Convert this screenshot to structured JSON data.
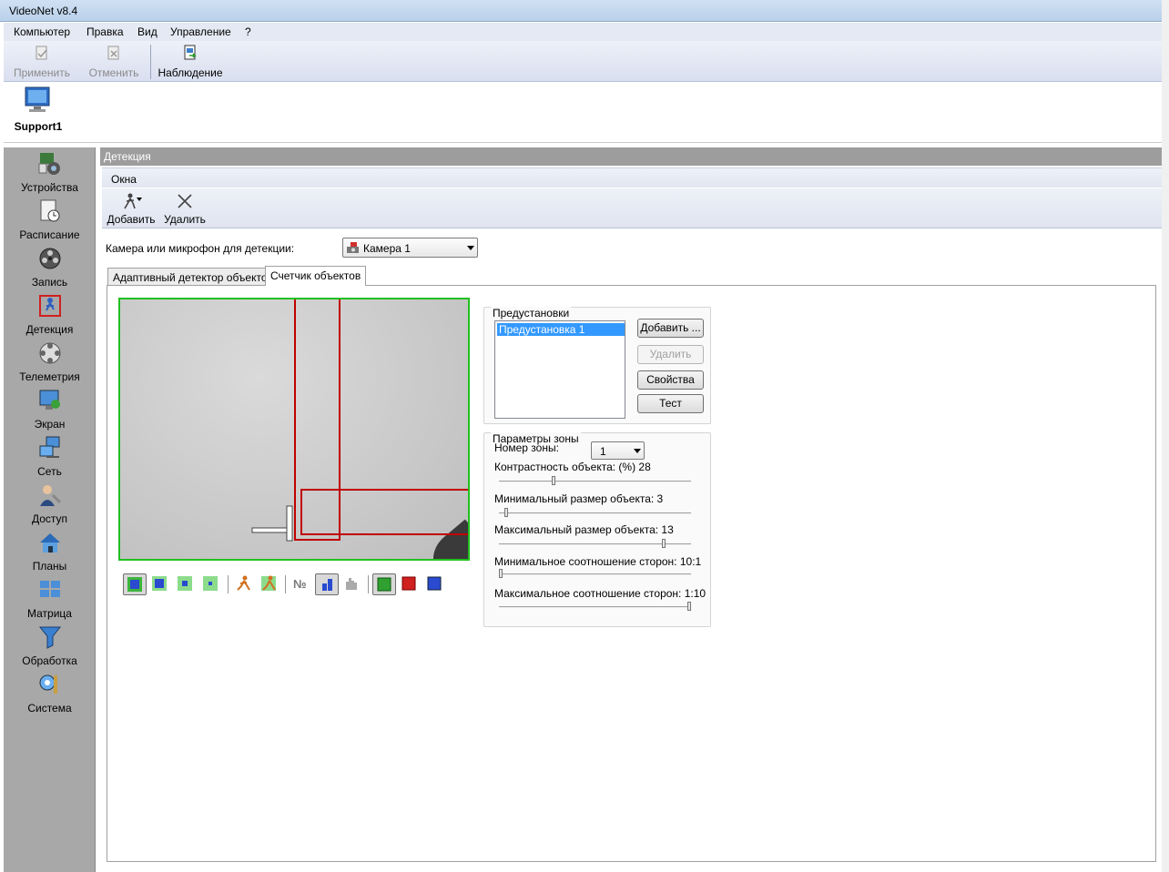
{
  "window": {
    "title": "VideoNet v8.4"
  },
  "menu": [
    "Компьютер",
    "Правка",
    "Вид",
    "Управление",
    "?"
  ],
  "toolbar": {
    "apply": "Применить",
    "cancel": "Отменить",
    "monitor": "Наблюдение"
  },
  "computer": {
    "name": "Support1"
  },
  "nav": [
    "Устройства",
    "Расписание",
    "Запись",
    "Детекция",
    "Телеметрия",
    "Экран",
    "Сеть",
    "Доступ",
    "Планы",
    "Матрица",
    "Обработка",
    "Система"
  ],
  "panel": {
    "title": "Детекция",
    "windows_menu": "Окна",
    "add": "Добавить",
    "delete": "Удалить",
    "camera_label": "Камера или микрофон для детекции:",
    "camera_value": "Камера  1",
    "tabs": [
      "Адаптивный детектор объектов",
      "Счетчик объектов"
    ]
  },
  "presets": {
    "title": "Предустановки",
    "items": [
      "Предустановка 1"
    ],
    "add": "Добавить ...",
    "delete": "Удалить",
    "props": "Свойства",
    "test": "Тест"
  },
  "zone": {
    "title": "Параметры зоны",
    "number_label": "Номер зоны:",
    "number_value": "1",
    "params": [
      {
        "label": "Контрастность объекта: (%) 28",
        "value": 28,
        "min": 0,
        "max": 100
      },
      {
        "label": "Минимальный размер объекта: 3",
        "value": 3,
        "min": 0,
        "max": 100
      },
      {
        "label": "Максимальный размер объекта: 13",
        "value": 13,
        "min": 0,
        "max": 15
      },
      {
        "label": "Минимальное соотношение сторон: 10:1",
        "value": 0,
        "min": 0,
        "max": 1
      },
      {
        "label": "Максимальное соотношение сторон: 1:10",
        "value": 1,
        "min": 0,
        "max": 1
      }
    ]
  },
  "colors": {
    "zone_border": "#c00000",
    "video_border": "#20c020",
    "selection": "#3399ff",
    "nav_bg": "#a8a8a8"
  }
}
